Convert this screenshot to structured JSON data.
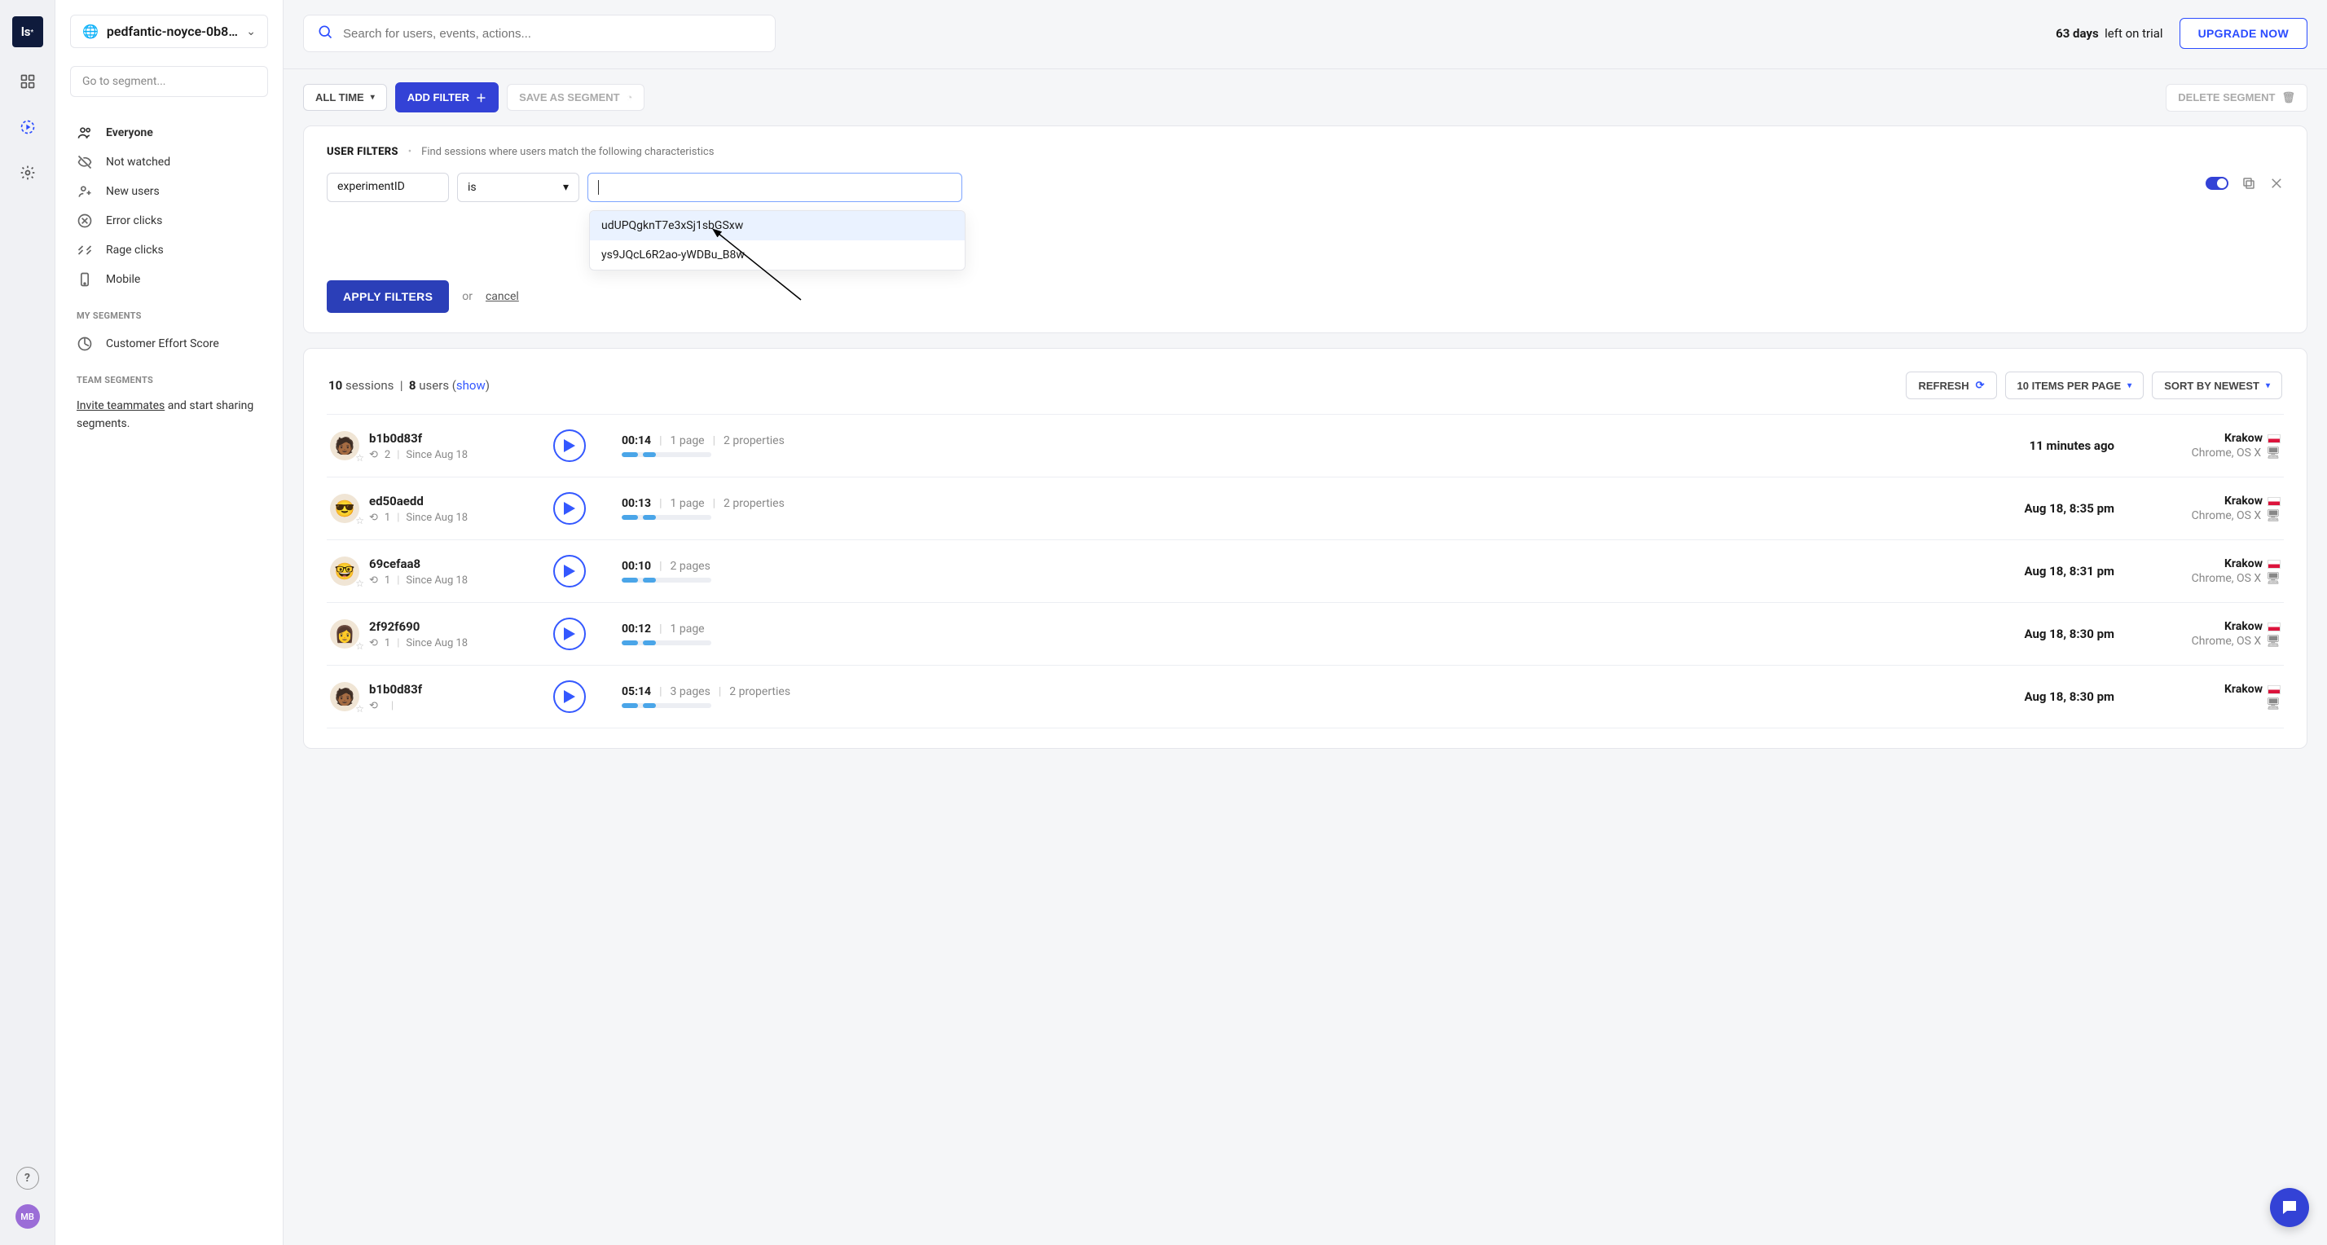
{
  "rail": {
    "logo_text": "ls",
    "avatar_initials": "MB"
  },
  "sidebar": {
    "project_name": "pedfantic-noyce-0b8d8...",
    "goto_placeholder": "Go to segment...",
    "segments": [
      {
        "icon": "users",
        "label": "Everyone",
        "active": true
      },
      {
        "icon": "eye-off",
        "label": "Not watched"
      },
      {
        "icon": "user-new",
        "label": "New users"
      },
      {
        "icon": "error",
        "label": "Error clicks"
      },
      {
        "icon": "rage",
        "label": "Rage clicks"
      },
      {
        "icon": "mobile",
        "label": "Mobile"
      }
    ],
    "my_segments_heading": "MY SEGMENTS",
    "my_segments": [
      {
        "icon": "gauge",
        "label": "Customer Effort Score"
      }
    ],
    "team_segments_heading": "TEAM SEGMENTS",
    "team_invite_text_prefix": "Invite teammates",
    "team_invite_text_suffix": " and start sharing segments."
  },
  "topbar": {
    "search_placeholder": "Search for users, events, actions...",
    "trial_days": "63 days",
    "trial_suffix": "left on trial",
    "upgrade_label": "UPGRADE NOW"
  },
  "toolbar": {
    "time_label": "ALL TIME",
    "add_filter_label": "ADD FILTER",
    "save_segment_label": "SAVE AS SEGMENT",
    "delete_segment_label": "DELETE SEGMENT"
  },
  "filters": {
    "title": "USER FILTERS",
    "description": "Find sessions where users match the following characteristics",
    "prop_label": "experimentID",
    "op_label": "is",
    "apply_label": "APPLY FILTERS",
    "or_label": "or",
    "cancel_label": "cancel",
    "suggestions": [
      "udUPQgknT7e3xSj1sbGSxw",
      "ys9JQcL6R2ao-yWDBu_B8w"
    ]
  },
  "sessions_header": {
    "sessions_count": "10",
    "sessions_word": "sessions",
    "users_count": "8",
    "users_word": "users",
    "show_label": "show",
    "refresh_label": "REFRESH",
    "per_page_label": "10 ITEMS PER PAGE",
    "sort_label": "SORT BY NEWEST"
  },
  "sessions": [
    {
      "id": "b1b0d83f",
      "repeat": "2",
      "since": "Since Aug 18",
      "duration": "00:14",
      "pages": "1 page",
      "props": "2 properties",
      "when": "11 minutes ago",
      "city": "Krakow",
      "device": "Chrome, OS X",
      "avatar": "🧑🏾"
    },
    {
      "id": "ed50aedd",
      "repeat": "1",
      "since": "Since Aug 18",
      "duration": "00:13",
      "pages": "1 page",
      "props": "2 properties",
      "when": "Aug 18, 8:35 pm",
      "city": "Krakow",
      "device": "Chrome, OS X",
      "avatar": "😎"
    },
    {
      "id": "69cefaa8",
      "repeat": "1",
      "since": "Since Aug 18",
      "duration": "00:10",
      "pages": "2 pages",
      "props": "",
      "when": "Aug 18, 8:31 pm",
      "city": "Krakow",
      "device": "Chrome, OS X",
      "avatar": "🤓"
    },
    {
      "id": "2f92f690",
      "repeat": "1",
      "since": "Since Aug 18",
      "duration": "00:12",
      "pages": "1 page",
      "props": "",
      "when": "Aug 18, 8:30 pm",
      "city": "Krakow",
      "device": "Chrome, OS X",
      "avatar": "👩"
    },
    {
      "id": "b1b0d83f",
      "repeat": "",
      "since": "",
      "duration": "05:14",
      "pages": "3 pages",
      "props": "2 properties",
      "when": "Aug 18, 8:30 pm",
      "city": "Krakow",
      "device": "",
      "avatar": "🧑🏾"
    }
  ]
}
